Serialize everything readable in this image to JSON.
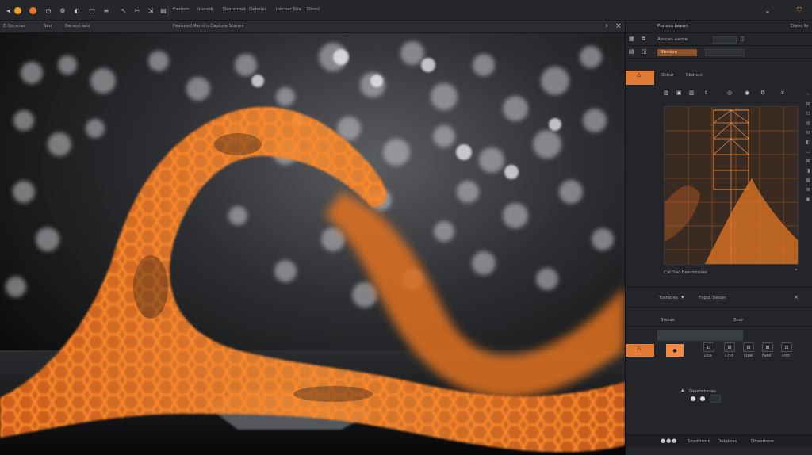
{
  "toolbar": {
    "menu": [
      "Eastern",
      "Inscerk",
      "Dsannrred",
      "Debeles",
      "Inkrbar Sire",
      "Dboct"
    ],
    "icons": [
      "back-arrow-icon",
      "user-icon",
      "circle-icon",
      "clock-icon",
      "gear-icon",
      "cloud-icon",
      "arrow-icon",
      "scissors-icon",
      "link-icon",
      "filter-icon",
      "chevron-down-icon",
      "shield-icon"
    ]
  },
  "viewport_bar": {
    "left_label": "E Qoceraa",
    "tab_a": "Seo",
    "tab_b": "Beraod lats",
    "center_title": "Featured Rendm Capture Stanes",
    "nav_right": "›",
    "close": "×"
  },
  "panel": {
    "title": "Punson beeon",
    "top_right": "Dleer lis",
    "row2_label": "Aoscan aacne",
    "row3_label": "Bbndan",
    "section_label": "Dbnar",
    "section_sub": "Sbdnaol",
    "tab_letter": "L",
    "footer_label": "Cat Sac Beermoteer",
    "props_left": "Tosredes",
    "props_right": "Foput Desan",
    "props_close": "×",
    "list_head": "Bretas",
    "list_head_right": "Bcor",
    "lower_label": "Deretetadas",
    "grid_labels": [
      "Dta",
      "Cnd",
      "Qpe",
      "Fate",
      "Dto"
    ],
    "bottom_items": [
      "Seadbsms",
      "Deteleas",
      "Dhaemere"
    ]
  }
}
